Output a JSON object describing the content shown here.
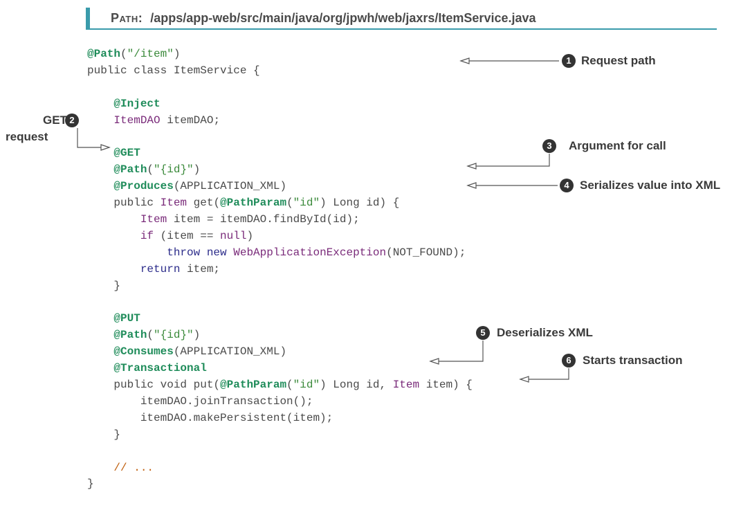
{
  "header": {
    "label": "Path:",
    "value": "/apps/app-web/src/main/java/org/jpwh/web/jaxrs/ItemService.java"
  },
  "code_lines": [
    [
      {
        "t": "@Path",
        "c": "ann"
      },
      {
        "t": "(",
        "c": ""
      },
      {
        "t": "\"/item\"",
        "c": "str"
      },
      {
        "t": ")",
        "c": ""
      }
    ],
    [
      {
        "t": "public class ItemService {",
        "c": ""
      }
    ],
    [],
    [
      {
        "t": "    ",
        "c": ""
      },
      {
        "t": "@Inject",
        "c": "ann"
      }
    ],
    [
      {
        "t": "    ",
        "c": ""
      },
      {
        "t": "ItemDAO",
        "c": "cls"
      },
      {
        "t": " itemDAO;",
        "c": ""
      }
    ],
    [],
    [
      {
        "t": "    ",
        "c": ""
      },
      {
        "t": "@GET",
        "c": "ann"
      }
    ],
    [
      {
        "t": "    ",
        "c": ""
      },
      {
        "t": "@Path",
        "c": "ann"
      },
      {
        "t": "(",
        "c": ""
      },
      {
        "t": "\"{id}\"",
        "c": "str"
      },
      {
        "t": ")",
        "c": ""
      }
    ],
    [
      {
        "t": "    ",
        "c": ""
      },
      {
        "t": "@Produces",
        "c": "ann"
      },
      {
        "t": "(APPLICATION_XML)",
        "c": ""
      }
    ],
    [
      {
        "t": "    public ",
        "c": ""
      },
      {
        "t": "Item",
        "c": "cls"
      },
      {
        "t": " get(",
        "c": ""
      },
      {
        "t": "@PathParam",
        "c": "ann"
      },
      {
        "t": "(",
        "c": ""
      },
      {
        "t": "\"id\"",
        "c": "str"
      },
      {
        "t": ") Long id) {",
        "c": ""
      }
    ],
    [
      {
        "t": "        ",
        "c": ""
      },
      {
        "t": "Item",
        "c": "cls"
      },
      {
        "t": " item = itemDAO.findById(id);",
        "c": ""
      }
    ],
    [
      {
        "t": "        ",
        "c": ""
      },
      {
        "t": "if",
        "c": "cls"
      },
      {
        "t": " (item == ",
        "c": ""
      },
      {
        "t": "null",
        "c": "cls"
      },
      {
        "t": ")",
        "c": ""
      }
    ],
    [
      {
        "t": "            ",
        "c": ""
      },
      {
        "t": "throw new",
        "c": "kw"
      },
      {
        "t": " ",
        "c": ""
      },
      {
        "t": "WebApplicationException",
        "c": "cls"
      },
      {
        "t": "(NOT_FOUND);",
        "c": ""
      }
    ],
    [
      {
        "t": "        ",
        "c": ""
      },
      {
        "t": "return",
        "c": "kw"
      },
      {
        "t": " item;",
        "c": ""
      }
    ],
    [
      {
        "t": "    }",
        "c": ""
      }
    ],
    [],
    [
      {
        "t": "    ",
        "c": ""
      },
      {
        "t": "@PUT",
        "c": "ann"
      }
    ],
    [
      {
        "t": "    ",
        "c": ""
      },
      {
        "t": "@Path",
        "c": "ann"
      },
      {
        "t": "(",
        "c": ""
      },
      {
        "t": "\"{id}\"",
        "c": "str"
      },
      {
        "t": ")",
        "c": ""
      }
    ],
    [
      {
        "t": "    ",
        "c": ""
      },
      {
        "t": "@Consumes",
        "c": "ann"
      },
      {
        "t": "(APPLICATION_XML)",
        "c": ""
      }
    ],
    [
      {
        "t": "    ",
        "c": ""
      },
      {
        "t": "@Transactional",
        "c": "ann"
      }
    ],
    [
      {
        "t": "    public void put(",
        "c": ""
      },
      {
        "t": "@PathParam",
        "c": "ann"
      },
      {
        "t": "(",
        "c": ""
      },
      {
        "t": "\"id\"",
        "c": "str"
      },
      {
        "t": ") Long id, ",
        "c": ""
      },
      {
        "t": "Item",
        "c": "cls"
      },
      {
        "t": " item) {",
        "c": ""
      }
    ],
    [
      {
        "t": "        itemDAO.joinTransaction();",
        "c": ""
      }
    ],
    [
      {
        "t": "        itemDAO.makePersistent(item);",
        "c": ""
      }
    ],
    [
      {
        "t": "    }",
        "c": ""
      }
    ],
    [],
    [
      {
        "t": "    ",
        "c": ""
      },
      {
        "t": "// ...",
        "c": "cmt"
      }
    ],
    [
      {
        "t": "}",
        "c": ""
      }
    ]
  ],
  "callouts": {
    "c1": {
      "number": "1",
      "text": "Request path"
    },
    "c2": {
      "number": "2",
      "text_line1": "GET",
      "text_line2": "request"
    },
    "c3": {
      "number": "3",
      "text": "Argument for call"
    },
    "c4": {
      "number": "4",
      "text": "Serializes value into XML"
    },
    "c5": {
      "number": "5",
      "text": "Deserializes XML"
    },
    "c6": {
      "number": "6",
      "text": "Starts transaction"
    }
  }
}
